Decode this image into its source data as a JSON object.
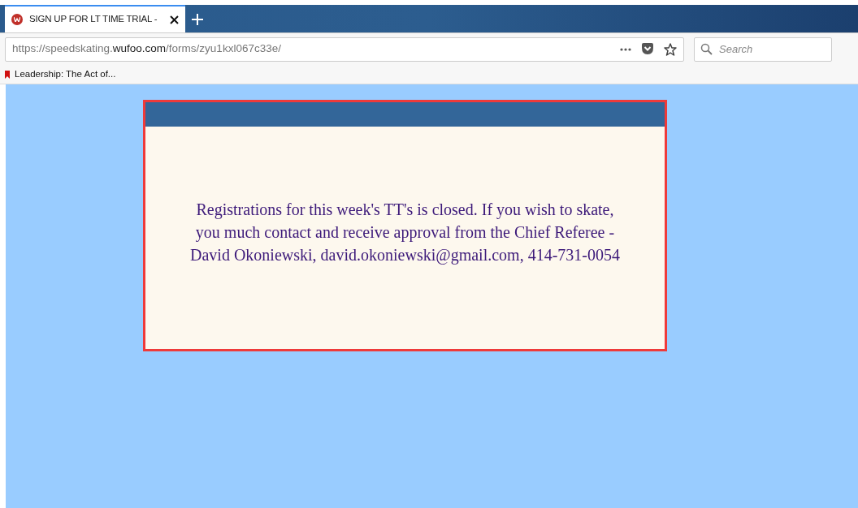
{
  "tab": {
    "title": "SIGN UP FOR LT TIME TRIAL -",
    "selected": true
  },
  "address": {
    "url": "https://speedskating.**wufoo.com**/forms/zyu1kxl067c33e/"
  },
  "search": {
    "placeholder": "Search"
  },
  "bookmarks": [
    "Leadership: The Act of..."
  ],
  "notice": {
    "lines": [
      "Registrations for this week's TT's is closed. If you wish to skate,",
      "you much contact and receive approval from the Chief Referee -",
      "David Okoniewski, david.okoniewski@gmail.com, 414-731-0054"
    ]
  }
}
